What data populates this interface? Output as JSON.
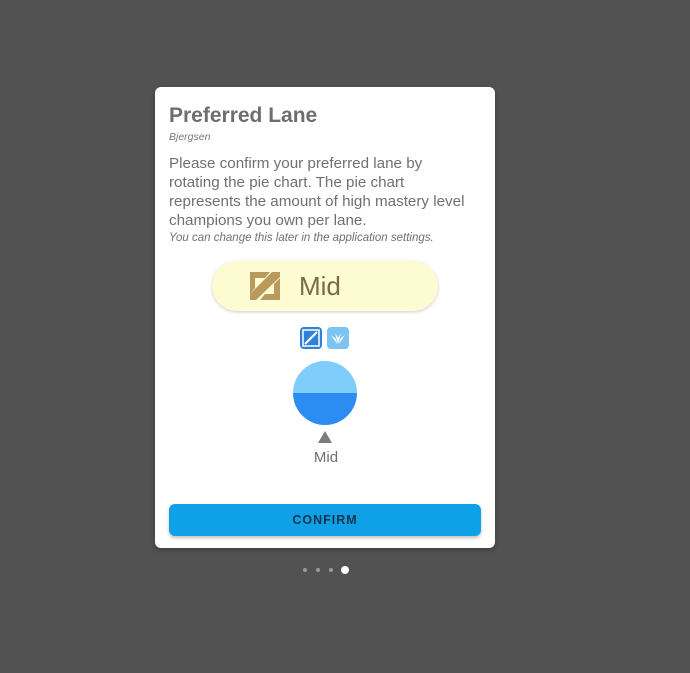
{
  "dialog": {
    "title": "Preferred Lane",
    "subtitle": "Bjergsen",
    "description": "Please confirm your preferred lane by rotating the pie chart. The pie chart represents the amount of high mastery level champions you own per lane.",
    "note": "You can change this later in the application settings.",
    "selected_lane": {
      "label": "Mid",
      "icon": "mid-lane-icon"
    },
    "lane_icons": [
      {
        "name": "mid-lane-icon",
        "color": "#2f82db"
      },
      {
        "name": "jungle-lane-icon",
        "color": "#7cc3f2"
      }
    ],
    "pie_label": "Mid",
    "confirm_label": "CONFIRM"
  },
  "pagination": {
    "total": 4,
    "active_index": 3
  },
  "colors": {
    "background": "#525252",
    "pill": "#fdfbd1",
    "accent": "#0ea1e7",
    "pie_mid": "#2b8cf2",
    "pie_jungle": "#7fcdfb"
  }
}
